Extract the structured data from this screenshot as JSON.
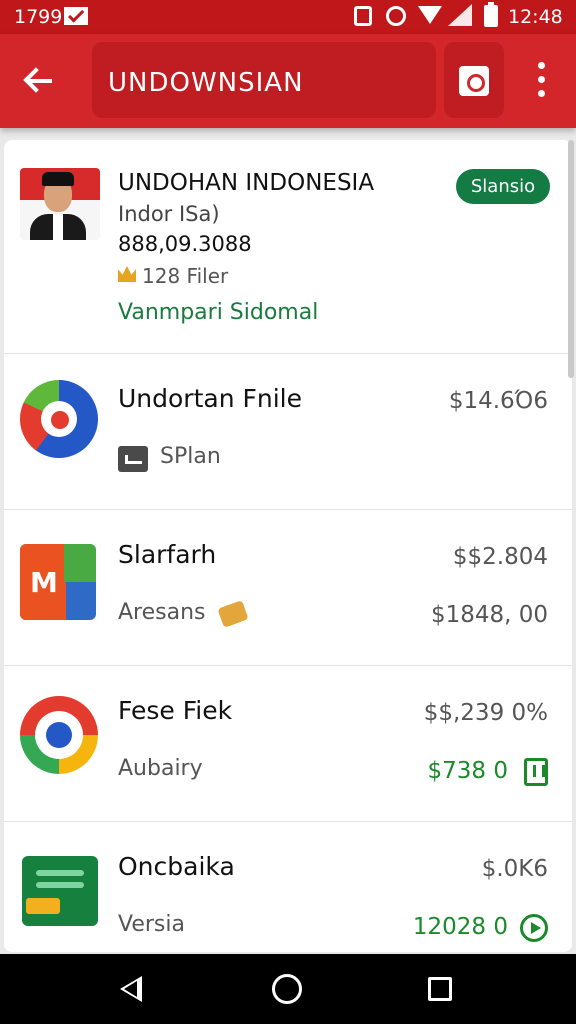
{
  "status_bar": {
    "time_left": "1799",
    "time_right": "12:48"
  },
  "app_bar": {
    "title": "UNDOWNSIAN"
  },
  "profile": {
    "name": "UNDOHAN INDOΝESIA",
    "subtitle": "Indor ISa)",
    "phone": "888,09.3088",
    "files": "128 Filer",
    "link": "Vanmpari Sidomal",
    "badge": "Slansio"
  },
  "files": [
    {
      "name": "Undortan Fnile",
      "sub": "SPlan",
      "price": "$14.6Ό6",
      "amount": ""
    },
    {
      "name": "Slarfarh",
      "sub": "Aresans",
      "price": "$$2.804",
      "amount": "$1848, 00"
    },
    {
      "name": "Fese Fiek",
      "sub": "Aubairy",
      "price": "$$,239 0%",
      "amount": "$738 0"
    },
    {
      "name": "Oncbaika",
      "sub": "Versia",
      "price": "$.0Κ6",
      "amount": "12028 0"
    }
  ],
  "colors": {
    "brand_red": "#d3262a",
    "status_red": "#c0171a",
    "accent_green": "#137b43",
    "amount_green": "#1b8a2b"
  },
  "icons": [
    "mail-icon",
    "sim-icon",
    "alarm-icon",
    "wifi-icon",
    "signal-icon",
    "battery-icon",
    "back-arrow-icon",
    "share-icon",
    "more-vert-icon",
    "crown-icon",
    "plan-icon",
    "coin-icon",
    "bag-icon",
    "play-circle-icon"
  ]
}
